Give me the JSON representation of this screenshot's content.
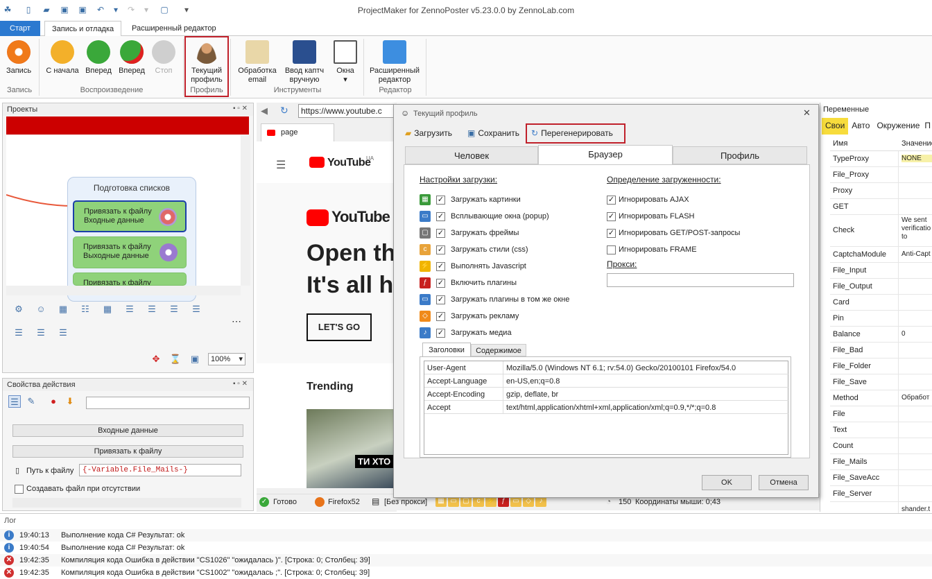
{
  "app": {
    "title": "ProjectMaker for ZennoPoster v5.23.0.0 by ZennoLab.com"
  },
  "ribbon_tabs": [
    "Старт",
    "Запись и отладка",
    "Расширенный редактор"
  ],
  "ribbon": {
    "record": {
      "label": "Запись",
      "group": "Запись"
    },
    "playback": {
      "group": "Воспроизведение",
      "from_start": "С начала",
      "forward": "Вперед",
      "forward2": "Вперед",
      "stop": "Стоп"
    },
    "profile": {
      "label_line1": "Текущий",
      "label_line2": "профиль",
      "group": "Профиль"
    },
    "tools": {
      "group": "Инструменты",
      "email_line1": "Обработка",
      "email_line2": "email",
      "captcha_line1": "Ввод каптч",
      "captcha_line2": "вручную",
      "windows": "Окна"
    },
    "editor": {
      "label_line1": "Расширенный",
      "label_line2": "редактор",
      "group": "Редактор"
    }
  },
  "projects": {
    "title": "Проекты",
    "group_title": "Подготовка списков",
    "nodes": [
      {
        "line1": "Привязать к файлу",
        "line2": "Входные данные"
      },
      {
        "line1": "Привязать к файлу",
        "line2": "Выходные данные"
      },
      {
        "line1": "Привязать к файлу",
        "line2": ""
      }
    ],
    "zoom": "100%"
  },
  "action_props": {
    "title": "Свойства действия",
    "input_data": "Входные данные",
    "bind_file": "Привязать к файлу",
    "path_label": "Путь к файлу",
    "path_value": "{-Variable.File_Mails-}",
    "create_if_missing": "Создавать файл при отсутствии"
  },
  "browser": {
    "url": "https://www.youtube.c",
    "tab": "page",
    "yt_logo": "YouTube",
    "yt_region": "UA",
    "yt_music": "YouTube M",
    "headline1": "Open th",
    "headline2": "It's all h",
    "cta": "LET'S GO",
    "trending": "Trending",
    "thumb_caption": "ТИ ХТО"
  },
  "status": {
    "ready": "Готово",
    "firefox": "Firefox52",
    "proxy": "[Без прокси]",
    "count": "150",
    "mouse": "Координаты мыши: 0;43"
  },
  "variables": {
    "title": "Переменные",
    "tabs": [
      "Свои",
      "Авто",
      "Окружение",
      "П"
    ],
    "col_name": "Имя",
    "col_value": "Значение",
    "rows": [
      {
        "name": "TypeProxy",
        "value": "NONE"
      },
      {
        "name": "File_Proxy",
        "value": ""
      },
      {
        "name": "Proxy",
        "value": ""
      },
      {
        "name": "GET",
        "value": ""
      },
      {
        "name": "Check",
        "value": "We sent verificatio to"
      },
      {
        "name": "CaptchaModule",
        "value": "Anti-Capt"
      },
      {
        "name": "File_Input",
        "value": ""
      },
      {
        "name": "File_Output",
        "value": ""
      },
      {
        "name": "Card",
        "value": ""
      },
      {
        "name": "Pin",
        "value": ""
      },
      {
        "name": "Balance",
        "value": "0"
      },
      {
        "name": "File_Bad",
        "value": ""
      },
      {
        "name": "File_Folder",
        "value": ""
      },
      {
        "name": "File_Save",
        "value": ""
      },
      {
        "name": "Method",
        "value": "Обработ"
      },
      {
        "name": "File",
        "value": ""
      },
      {
        "name": "Text",
        "value": ""
      },
      {
        "name": "Count",
        "value": ""
      },
      {
        "name": "File_Mails",
        "value": ""
      },
      {
        "name": "File_SaveAcc",
        "value": ""
      },
      {
        "name": "File_Server",
        "value": ""
      },
      {
        "name": "",
        "value": "shander.t"
      }
    ]
  },
  "log": {
    "title": "Лог",
    "rows": [
      {
        "level": "info",
        "time": "19:40:13",
        "msg": "Выполнение кода C#  Результат: ok"
      },
      {
        "level": "info",
        "time": "19:40:54",
        "msg": "Выполнение кода C#  Результат: ok"
      },
      {
        "level": "error",
        "time": "19:42:35",
        "msg": "Компиляция кода  Ошибка в действии \"CS1026\" \"ожидалась )\". [Строка: 0; Столбец: 39]"
      },
      {
        "level": "error",
        "time": "19:42:35",
        "msg": "Компиляция кода  Ошибка в действии \"CS1002\" \"ожидалась ;\". [Строка: 0; Столбец: 39]"
      }
    ]
  },
  "dialog": {
    "title": "Текущий профиль",
    "load": "Загрузить",
    "save": "Сохранить",
    "regenerate": "Перегенерировать",
    "tabs": [
      "Человек",
      "Браузер",
      "Профиль"
    ],
    "load_settings_title": "Настройки загрузки:",
    "load_settings": [
      {
        "label": "Загружать картинки",
        "checked": true,
        "icon": "image-icon",
        "color": "#3a9a3a"
      },
      {
        "label": "Всплывающие окна (popup)",
        "checked": true,
        "icon": "popup-icon",
        "color": "#3b7bc8"
      },
      {
        "label": "Загружать фреймы",
        "checked": true,
        "icon": "frame-icon",
        "color": "#777777"
      },
      {
        "label": "Загружать стили (css)",
        "checked": true,
        "icon": "css-icon",
        "color": "#e8a33a"
      },
      {
        "label": "Выполнять Javascript",
        "checked": true,
        "icon": "lightning-icon",
        "color": "#f0b400"
      },
      {
        "label": "Включить плагины",
        "checked": true,
        "icon": "flash-icon",
        "color": "#c8201e"
      },
      {
        "label": "Загружать плагины в том же окне",
        "checked": true,
        "icon": "monitor-icon",
        "color": "#3b7bc8"
      },
      {
        "label": "Загружать рекламу",
        "checked": true,
        "icon": "ad-icon",
        "color": "#f08a1a"
      },
      {
        "label": "Загружать медиа",
        "checked": true,
        "icon": "music-icon",
        "color": "#3b7bc8"
      }
    ],
    "busy_title": "Определение загруженности:",
    "busy_settings": [
      {
        "label": "Игнорировать AJAX",
        "checked": true
      },
      {
        "label": "Игнорировать FLASH",
        "checked": true
      },
      {
        "label": "Игнорировать GET/POST-запросы",
        "checked": true
      },
      {
        "label": "Игнорировать FRAME",
        "checked": false
      }
    ],
    "proxy_label": "Прокси:",
    "proxy_value": "",
    "sub_tabs": [
      "Заголовки",
      "Содержимое"
    ],
    "headers": [
      {
        "key": "User-Agent",
        "value": "Mozilla/5.0 (Windows NT 6.1; rv:54.0) Gecko/20100101 Firefox/54.0"
      },
      {
        "key": "Accept-Language",
        "value": "en-US,en;q=0.8"
      },
      {
        "key": "Accept-Encoding",
        "value": "gzip, deflate, br"
      },
      {
        "key": "Accept",
        "value": "text/html,application/xhtml+xml,application/xml;q=0.9,*/*;q=0.8"
      }
    ],
    "ok": "OK",
    "cancel": "Отмена"
  },
  "colors": {
    "accent": "#2b79d0",
    "highlight": "#c0202a",
    "node_green": "#8fd27a",
    "youtube_red": "#ff0000"
  }
}
